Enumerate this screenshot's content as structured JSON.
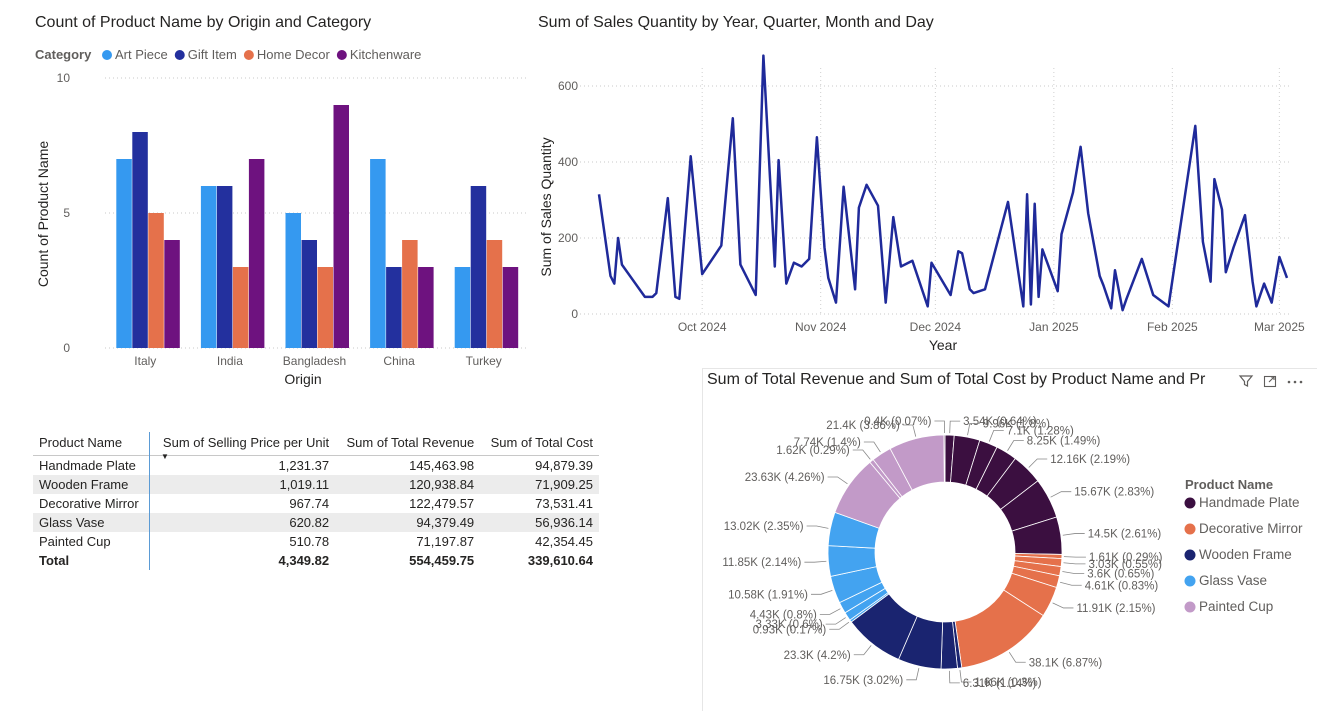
{
  "bar_chart": {
    "title": "Count of Product Name by Origin and Category",
    "legend_title": "Category",
    "xlabel": "Origin",
    "ylabel": "Count of Product Name",
    "yticks": [
      "0",
      "5",
      "10"
    ]
  },
  "line_chart": {
    "title": "Sum of Sales Quantity by Year, Quarter, Month and Day",
    "xlabel": "Year",
    "ylabel": "Sum of Sales Quantity",
    "yticks": [
      "0",
      "200",
      "400",
      "600"
    ],
    "xticks": [
      "Oct 2024",
      "Nov 2024",
      "Dec 2024",
      "Jan 2025",
      "Feb 2025",
      "Mar 2025"
    ]
  },
  "donut_chart": {
    "title": "Sum of Total Revenue and Sum of Total Cost by Product Name and Pr",
    "legend_title": "Product Name",
    "filter_icon": "filter-icon",
    "focus_icon": "focus-mode-icon",
    "more_icon": "more-options-icon",
    "labels": {
      "l0": "0.4K (0.07%)",
      "l1": "3.54K (0.64%)",
      "l2": "9.96K (1.8%)",
      "l3": "7.1K (1.28%)",
      "l4": "8.25K (1.49%)",
      "l5": "12.16K (2.19%)",
      "l6": "15.67K (2.83%)",
      "l7": "14.5K (2.61%)",
      "l8": "1.61K (0.29%)",
      "l9": "3.03K (0.55%)",
      "l10": "3.6K (0.65%)",
      "l11": "4.61K (0.83%)",
      "l12": "11.91K (2.15%)",
      "l13": "38.1K (6.87%)",
      "l14": "1.66K (0.3%)",
      "l15": "6.31K (1.14%)",
      "l16": "16.75K (3.02%)",
      "l17": "23.3K (4.2%)",
      "l18": "0.93K (0.17%)",
      "l19": "3.33K (0.6%)",
      "l20": "4.43K (0.8%)",
      "l21": "10.58K (1.91%)",
      "l22": "11.85K (2.14%)",
      "l23": "13.02K (2.35%)",
      "l24": "23.63K (4.26%)",
      "l25": "1.62K (0.29%)",
      "l26": "7.74K (1.4%)",
      "l27": "21.4K (3.86%)"
    }
  },
  "table": {
    "columns": [
      "Product Name",
      "Sum of Selling Price per Unit",
      "Sum of Total Revenue",
      "Sum of Total Cost"
    ],
    "rows": [
      [
        "Handmade Plate",
        "1,231.37",
        "145,463.98",
        "94,879.39"
      ],
      [
        "Wooden Frame",
        "1,019.11",
        "120,938.84",
        "71,909.25"
      ],
      [
        "Decorative Mirror",
        "967.74",
        "122,479.57",
        "73,531.41"
      ],
      [
        "Glass Vase",
        "620.82",
        "94,379.49",
        "56,936.14"
      ],
      [
        "Painted Cup",
        "510.78",
        "71,197.87",
        "42,354.45"
      ]
    ],
    "total": [
      "Total",
      "4,349.82",
      "554,459.75",
      "339,610.64"
    ]
  },
  "chart_data": [
    {
      "type": "bar",
      "title": "Count of Product Name by Origin and Category",
      "xlabel": "Origin",
      "ylabel": "Count of Product Name",
      "ylim": [
        0,
        10
      ],
      "legend_placement": "top-left",
      "categories": [
        "Italy",
        "India",
        "Bangladesh",
        "China",
        "Turkey"
      ],
      "series": [
        {
          "name": "Art Piece",
          "color": "#3599f0",
          "values": [
            7,
            6,
            5,
            7,
            3
          ]
        },
        {
          "name": "Gift Item",
          "color": "#23309e",
          "values": [
            8,
            6,
            4,
            3,
            6
          ]
        },
        {
          "name": "Home Decor",
          "color": "#e5714b",
          "values": [
            5,
            3,
            3,
            4,
            4
          ]
        },
        {
          "name": "Kitchenware",
          "color": "#6e127f",
          "values": [
            4,
            7,
            9,
            3,
            3
          ]
        }
      ]
    },
    {
      "type": "line",
      "title": "Sum of Sales Quantity by Year, Quarter, Month and Day",
      "xlabel": "Year",
      "ylabel": "Sum of Sales Quantity",
      "ylim": [
        0,
        700
      ],
      "color": "#1f2a9a",
      "x": [
        "2024-09-04",
        "2024-09-07",
        "2024-09-08",
        "2024-09-09",
        "2024-09-10",
        "2024-09-16",
        "2024-09-18",
        "2024-09-19",
        "2024-09-22",
        "2024-09-24",
        "2024-09-25",
        "2024-09-28",
        "2024-10-01",
        "2024-10-06",
        "2024-10-09",
        "2024-10-11",
        "2024-10-15",
        "2024-10-17",
        "2024-10-20",
        "2024-10-21",
        "2024-10-23",
        "2024-10-25",
        "2024-10-27",
        "2024-10-29",
        "2024-10-31",
        "2024-11-02",
        "2024-11-03",
        "2024-11-05",
        "2024-11-07",
        "2024-11-10",
        "2024-11-11",
        "2024-11-13",
        "2024-11-16",
        "2024-11-18",
        "2024-11-20",
        "2024-11-22",
        "2024-11-25",
        "2024-11-29",
        "2024-11-30",
        "2024-12-05",
        "2024-12-07",
        "2024-12-08",
        "2024-12-10",
        "2024-12-11",
        "2024-12-14",
        "2024-12-20",
        "2024-12-24",
        "2024-12-25",
        "2024-12-26",
        "2024-12-27",
        "2024-12-28",
        "2024-12-29",
        "2025-01-02",
        "2025-01-03",
        "2025-01-06",
        "2025-01-08",
        "2025-01-10",
        "2025-01-13",
        "2025-01-14",
        "2025-01-16",
        "2025-01-17",
        "2025-01-19",
        "2025-01-20",
        "2025-01-24",
        "2025-01-27",
        "2025-01-31",
        "2025-02-07",
        "2025-02-09",
        "2025-02-11",
        "2025-02-12",
        "2025-02-14",
        "2025-02-15",
        "2025-02-17",
        "2025-02-20",
        "2025-02-22",
        "2025-02-23",
        "2025-02-25",
        "2025-02-27",
        "2025-03-01",
        "2025-03-03"
      ],
      "y": [
        315,
        100,
        80,
        200,
        130,
        45,
        45,
        55,
        305,
        45,
        40,
        415,
        105,
        180,
        515,
        130,
        50,
        680,
        125,
        405,
        80,
        135,
        125,
        145,
        465,
        175,
        95,
        30,
        335,
        65,
        280,
        340,
        285,
        30,
        255,
        125,
        140,
        20,
        135,
        50,
        165,
        160,
        65,
        55,
        65,
        295,
        20,
        315,
        25,
        290,
        45,
        170,
        60,
        210,
        320,
        440,
        265,
        100,
        75,
        15,
        115,
        10,
        40,
        145,
        50,
        20,
        495,
        190,
        85,
        355,
        275,
        110,
        175,
        260,
        85,
        20,
        80,
        30,
        150,
        95
      ]
    },
    {
      "type": "pie",
      "subtype": "donut",
      "title": "Sum of Total Revenue and Sum of Total Cost by Product Name and Pr",
      "legend_placement": "right",
      "legend": [
        {
          "name": "Handmade Plate",
          "color": "#3b0f40"
        },
        {
          "name": "Decorative Mirror",
          "color": "#e5714b"
        },
        {
          "name": "Wooden Frame",
          "color": "#1a2470"
        },
        {
          "name": "Glass Vase",
          "color": "#43a3f0"
        },
        {
          "name": "Painted Cup",
          "color": "#c29ac8"
        }
      ],
      "slices": [
        {
          "group": "Handmade Plate",
          "value": 3.54,
          "percent": 0.64
        },
        {
          "group": "Handmade Plate",
          "value": 9.96,
          "percent": 1.8
        },
        {
          "group": "Handmade Plate",
          "value": 7.1,
          "percent": 1.28
        },
        {
          "group": "Handmade Plate",
          "value": 8.25,
          "percent": 1.49
        },
        {
          "group": "Handmade Plate",
          "value": 12.16,
          "percent": 2.19
        },
        {
          "group": "Handmade Plate",
          "value": 15.67,
          "percent": 2.83
        },
        {
          "group": "Handmade Plate",
          "value": 14.5,
          "percent": 2.61
        },
        {
          "group": "Decorative Mirror",
          "value": 1.61,
          "percent": 0.29
        },
        {
          "group": "Decorative Mirror",
          "value": 3.03,
          "percent": 0.55
        },
        {
          "group": "Decorative Mirror",
          "value": 3.6,
          "percent": 0.65
        },
        {
          "group": "Decorative Mirror",
          "value": 4.61,
          "percent": 0.83
        },
        {
          "group": "Decorative Mirror",
          "value": 11.91,
          "percent": 2.15
        },
        {
          "group": "Decorative Mirror",
          "value": 38.1,
          "percent": 6.87
        },
        {
          "group": "Wooden Frame",
          "value": 1.66,
          "percent": 0.3
        },
        {
          "group": "Wooden Frame",
          "value": 6.31,
          "percent": 1.14
        },
        {
          "group": "Wooden Frame",
          "value": 16.75,
          "percent": 3.02
        },
        {
          "group": "Wooden Frame",
          "value": 23.3,
          "percent": 4.2
        },
        {
          "group": "Glass Vase",
          "value": 0.93,
          "percent": 0.17
        },
        {
          "group": "Glass Vase",
          "value": 3.33,
          "percent": 0.6
        },
        {
          "group": "Glass Vase",
          "value": 4.43,
          "percent": 0.8
        },
        {
          "group": "Glass Vase",
          "value": 10.58,
          "percent": 1.91
        },
        {
          "group": "Glass Vase",
          "value": 11.85,
          "percent": 2.14
        },
        {
          "group": "Glass Vase",
          "value": 13.02,
          "percent": 2.35
        },
        {
          "group": "Painted Cup",
          "value": 23.63,
          "percent": 4.26
        },
        {
          "group": "Painted Cup",
          "value": 1.62,
          "percent": 0.29
        },
        {
          "group": "Painted Cup",
          "value": 7.74,
          "percent": 1.4
        },
        {
          "group": "Painted Cup",
          "value": 21.4,
          "percent": 3.86
        },
        {
          "group": "Handmade Plate",
          "value": 0.4,
          "percent": 0.07
        }
      ]
    }
  ]
}
